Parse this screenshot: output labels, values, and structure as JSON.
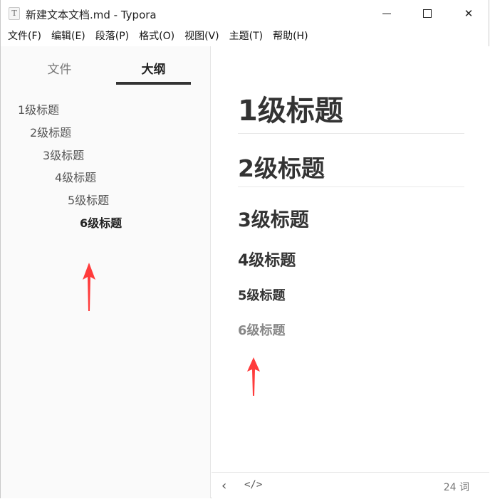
{
  "window": {
    "title": "新建文本文档.md - Typora",
    "app_icon_letter": "T",
    "controls": {
      "close_glyph": "✕"
    }
  },
  "menu": [
    "文件(F)",
    "编辑(E)",
    "段落(P)",
    "格式(O)",
    "视图(V)",
    "主题(T)",
    "帮助(H)"
  ],
  "sidebar": {
    "tabs": {
      "files": "文件",
      "outline": "大纲"
    },
    "outline": [
      "1级标题",
      "2级标题",
      "3级标题",
      "4级标题",
      "5级标题",
      "6级标题"
    ]
  },
  "editor": {
    "headings": [
      "1级标题",
      "2级标题",
      "3级标题",
      "4级标题",
      "5级标题",
      "6级标题"
    ]
  },
  "statusbar": {
    "back_glyph": "‹",
    "source_glyph": "</>",
    "word_count": "24 词"
  },
  "colors": {
    "annotation_arrow": "#ff3b3b",
    "active_tab_underline": "#333333"
  }
}
